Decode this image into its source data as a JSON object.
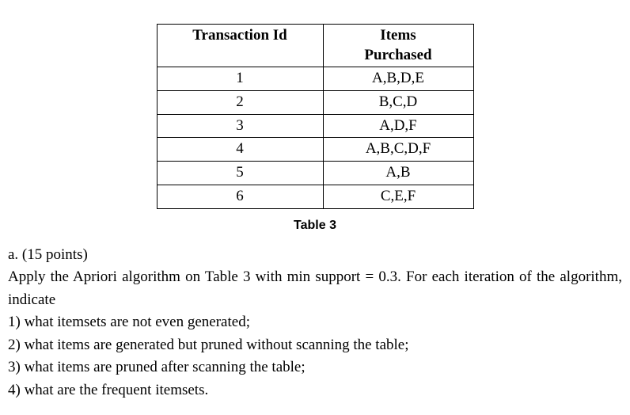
{
  "table": {
    "headers": {
      "transaction_id": "Transaction Id",
      "items_purchased_line1": "Items",
      "items_purchased_line2": "Purchased"
    },
    "rows": [
      {
        "id": "1",
        "items": "A,B,D,E"
      },
      {
        "id": "2",
        "items": "B,C,D"
      },
      {
        "id": "3",
        "items": "A,D,F"
      },
      {
        "id": "4",
        "items": "A,B,C,D,F"
      },
      {
        "id": "5",
        "items": "A,B"
      },
      {
        "id": "6",
        "items": "C,E,F"
      }
    ]
  },
  "caption": "Table 3",
  "question": {
    "part_label": "a. (15 points)",
    "intro": "Apply the Apriori algorithm on Table 3 with min support = 0.3. For each iteration of the algorithm, indicate",
    "items": [
      "1) what itemsets are not even generated;",
      "2) what items are generated but pruned without scanning the table;",
      "3) what items are pruned after scanning the table;",
      "4) what are the frequent itemsets."
    ]
  },
  "chart_data": {
    "type": "table",
    "title": "Table 3",
    "columns": [
      "Transaction Id",
      "Items Purchased"
    ],
    "rows": [
      [
        "1",
        "A,B,D,E"
      ],
      [
        "2",
        "B,C,D"
      ],
      [
        "3",
        "A,D,F"
      ],
      [
        "4",
        "A,B,C,D,F"
      ],
      [
        "5",
        "A,B"
      ],
      [
        "6",
        "C,E,F"
      ]
    ]
  }
}
